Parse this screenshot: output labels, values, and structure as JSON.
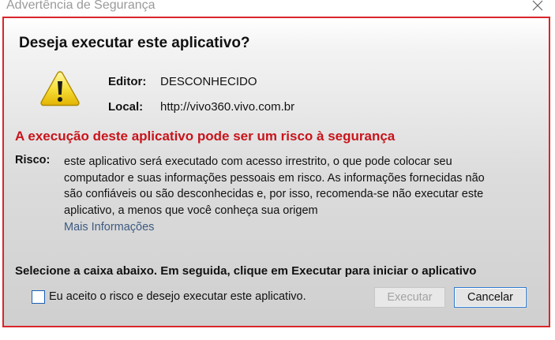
{
  "window": {
    "title": "Advertência de Segurança",
    "close_glyph": "✕"
  },
  "dialog": {
    "heading": "Deseja executar este aplicativo?",
    "icon": "warning-icon",
    "publisher_label": "Editor:",
    "publisher_value": "DESCONHECIDO",
    "location_label": "Local:",
    "location_value": "http://vivo360.vivo.com.br",
    "risk_headline": "A execução deste aplicativo pode ser um risco à segurança",
    "risk_label": "Risco:",
    "risk_lines": [
      "este aplicativo será executado com acesso irrestrito, o que pode colocar seu",
      "computador e suas informações pessoais em risco. As informações fornecidas não",
      "são confiáveis ou são desconhecidas e, por isso, recomenda-se não executar este",
      "aplicativo, a menos que você conheça sua origem"
    ],
    "more_info_link": "Mais Informações",
    "instruction": "Selecione a caixa abaixo. Em seguida, clique em Executar para iniciar o aplicativo",
    "accept_checkbox_label": "Eu aceito o risco e desejo executar este aplicativo.",
    "accept_checked": false,
    "run_button": "Executar",
    "run_enabled": false,
    "cancel_button": "Cancelar"
  },
  "colors": {
    "border": "#d9262c",
    "risk_headline": "#c8141b",
    "link": "#3d5a80",
    "focus_border": "#2e7bd1"
  }
}
